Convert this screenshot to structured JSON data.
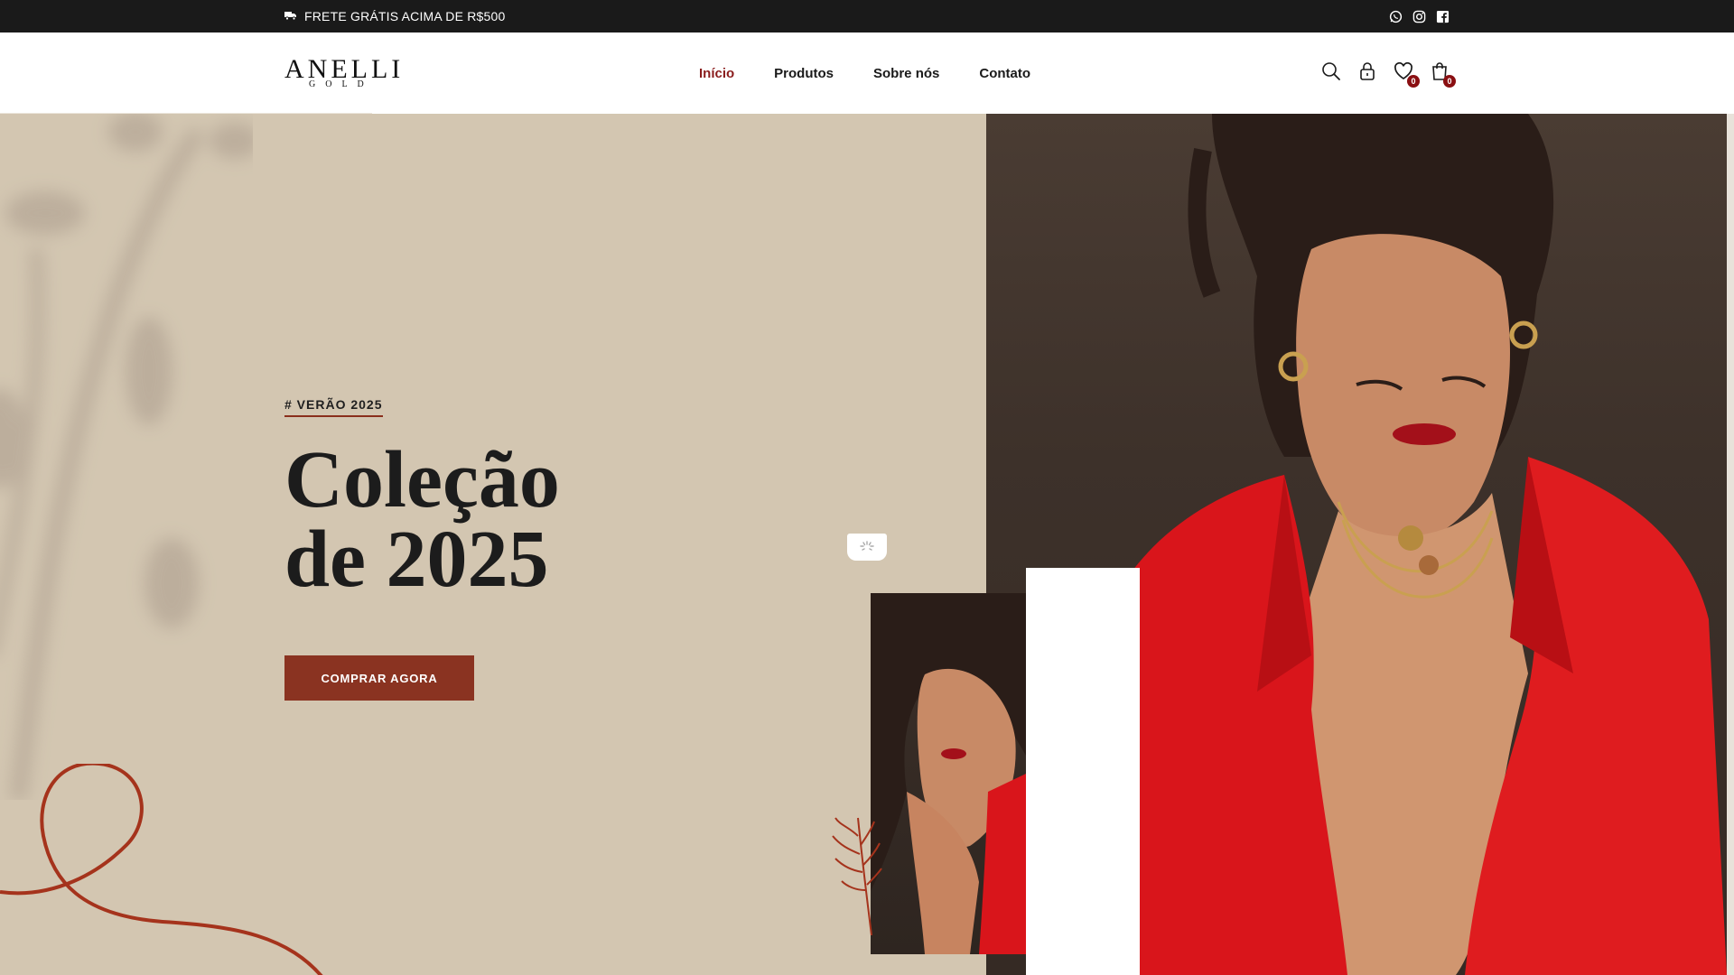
{
  "topbar": {
    "promo_text": "FRETE GRÁTIS ACIMA DE R$500",
    "promo_icon": "truck-icon",
    "socials": [
      "whatsapp-icon",
      "instagram-icon",
      "facebook-icon"
    ]
  },
  "header": {
    "logo_brand": "ANELLI",
    "logo_sub": "GOLD",
    "nav": [
      {
        "label": "Início",
        "active": true
      },
      {
        "label": "Produtos",
        "active": false
      },
      {
        "label": "Sobre nós",
        "active": false
      },
      {
        "label": "Contato",
        "active": false
      }
    ],
    "icons": [
      "search-icon",
      "lock-icon",
      "heart-icon",
      "cart-icon"
    ],
    "wishlist_count": "0",
    "cart_count": "0"
  },
  "hero": {
    "tagline": "# VERÃO 2025",
    "title_line1": "Coleção",
    "title_line2": "de 2025",
    "cta_label": "COMPRAR AGORA"
  },
  "colors": {
    "hero_bg": "#d3c6b1",
    "accent": "#8a3321",
    "nav_active": "#8a1c1c",
    "topbar_bg": "#1a1a1a",
    "badge": "#8a0f12"
  }
}
